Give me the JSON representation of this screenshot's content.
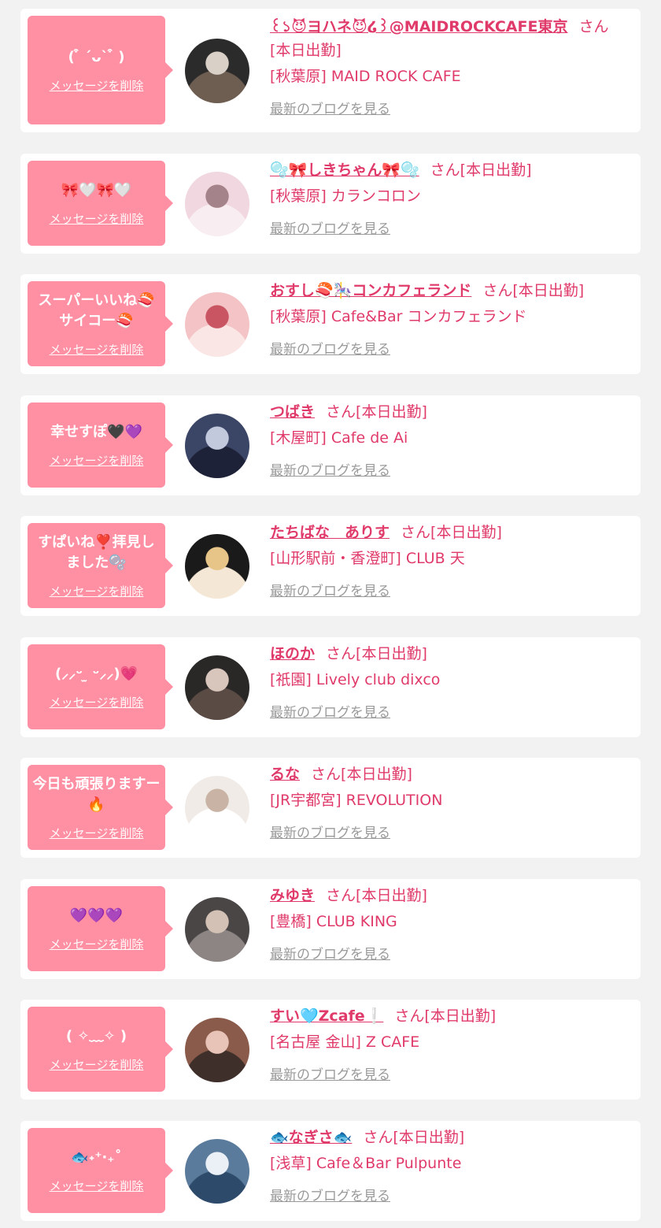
{
  "common": {
    "delete_label": "メッセージを削除",
    "blog_label": "最新のブログを見る",
    "san_label": "さん",
    "status_label": "[本日出勤]"
  },
  "messages": [
    {
      "bubble": "( ͒ ˊᴗˋ ͒ )",
      "name": "꒰১😈ヨハネ😈໒꒱@MAIDROCKCAFE東京",
      "store": "[秋葉原] MAID ROCK CAFE",
      "avatar_colors": [
        "#2b2b2b",
        "#d9d0c8",
        "#6e5e52"
      ]
    },
    {
      "bubble": "🎀🤍🎀🤍",
      "name": "🫧🎀しきちゃん🎀🫧",
      "store": "[秋葉原] カランコロン",
      "avatar_colors": [
        "#f1d7df",
        "#a5838a",
        "#f8eef1"
      ]
    },
    {
      "bubble": "スーパーいいね🍣サイコー🍣",
      "name": "おすし🍣🎠コンカフェランド",
      "store": "[秋葉原] Cafe&Bar コンカフェランド",
      "avatar_colors": [
        "#f3c3c5",
        "#c95563",
        "#fbe6e6"
      ]
    },
    {
      "bubble": "幸せすぽ🖤💜",
      "name": "つばき",
      "store": "[木屋町] Cafe de Ai",
      "avatar_colors": [
        "#3b4566",
        "#c2c9dd",
        "#1e2238"
      ]
    },
    {
      "bubble": "すぱいね❣️拝見しました🫧",
      "name": "たちばな　ありす",
      "store": "[山形駅前・香澄町] CLUB 天",
      "avatar_colors": [
        "#1a1a1a",
        "#e7c488",
        "#f5e7d6"
      ]
    },
    {
      "bubble": "(⸝⸝ᵕ ̫ ᵕ⸝⸝)💗",
      "name": "ほのか",
      "store": "[祇園] Lively club dixco",
      "avatar_colors": [
        "#2a2727",
        "#d8c6bd",
        "#5a4b45"
      ]
    },
    {
      "bubble": "今日も頑張りますー🔥",
      "name": "るな",
      "store": "[JR宇都宮] REVOLUTION",
      "avatar_colors": [
        "#f0ebe6",
        "#c8b3a5",
        "#ffffff"
      ]
    },
    {
      "bubble": "💜💜💜",
      "name": "みゆき",
      "store": "[豊橋] CLUB KING",
      "avatar_colors": [
        "#4a4646",
        "#d4c1b6",
        "#8c8584"
      ]
    },
    {
      "bubble": "( ✧﹏✧ )",
      "name": "すい🩵Zcafe❕",
      "store": "[名古屋 金山] Z CAFE",
      "avatar_colors": [
        "#8a5a4a",
        "#e8c3b8",
        "#3e2f2a"
      ]
    },
    {
      "bubble": "🐟˖⁺‧₊˚",
      "name": "🐟なぎさ🐟",
      "store": "[浅草] Cafe＆Bar Pulpunte",
      "avatar_colors": [
        "#5a7b9b",
        "#eaf0f5",
        "#2e4a6b"
      ]
    }
  ]
}
